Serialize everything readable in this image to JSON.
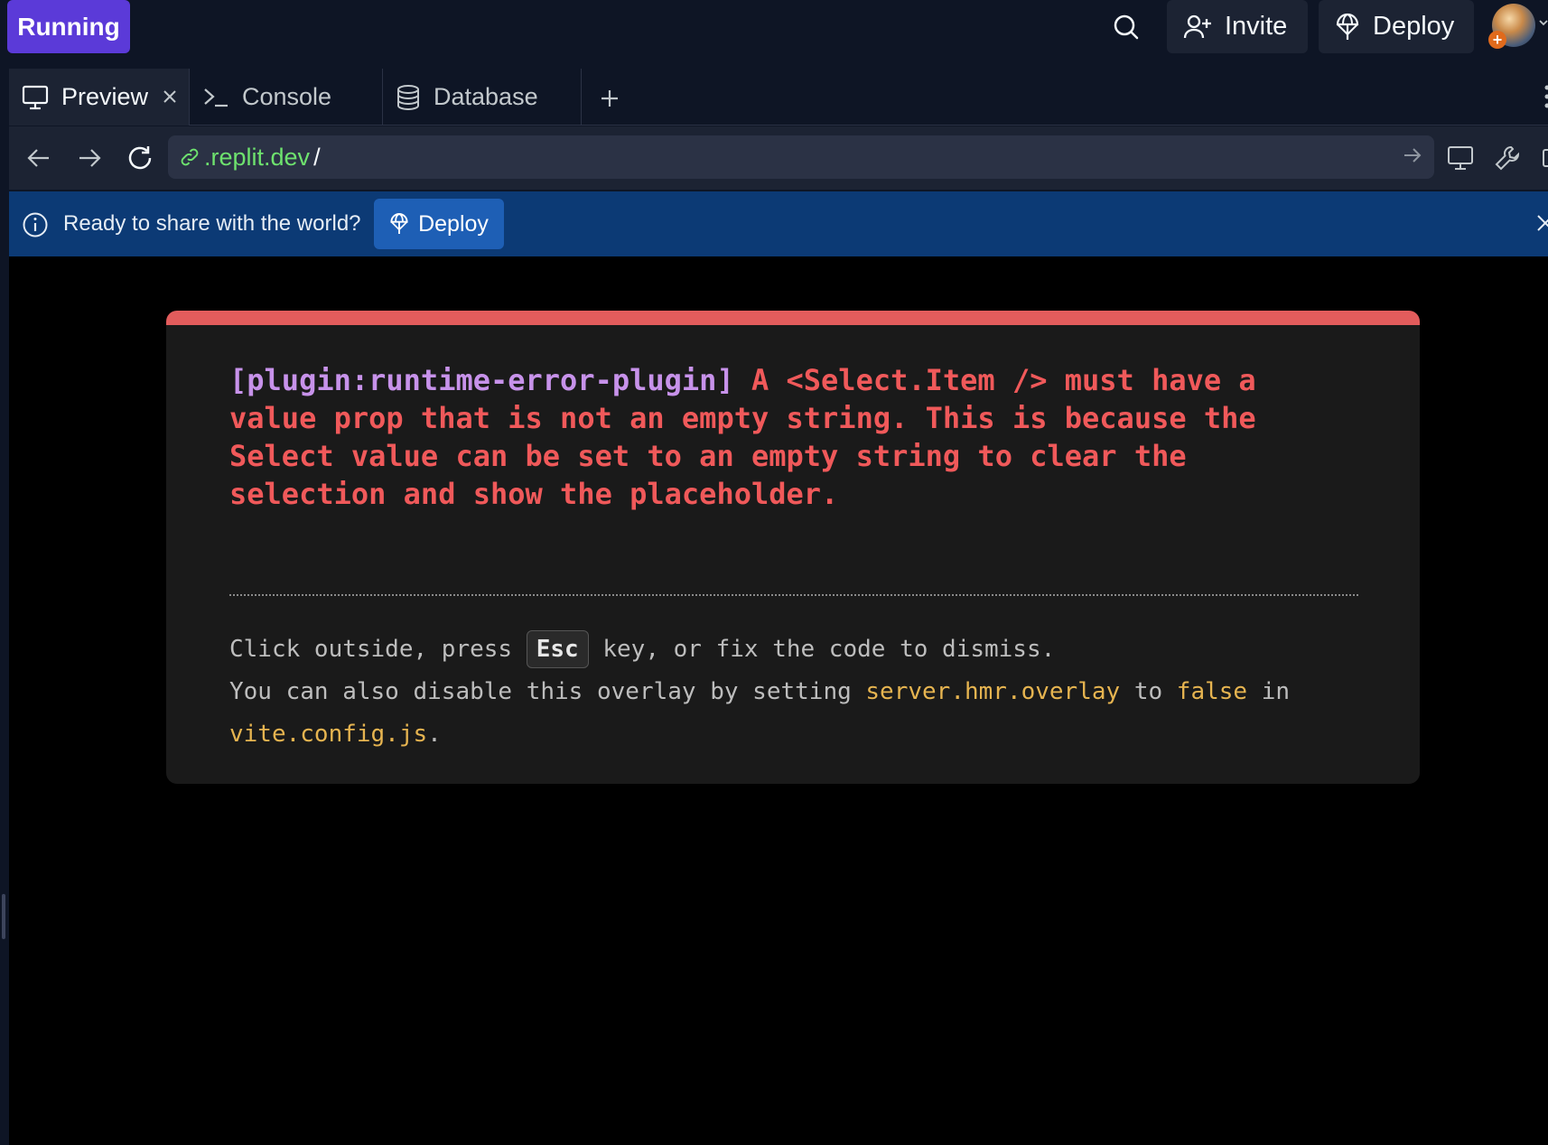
{
  "topbar": {
    "run_label": "Running",
    "invite_label": "Invite",
    "deploy_label": "Deploy",
    "icons": [
      "search-icon",
      "add-user-icon",
      "deploy-icon",
      "avatar",
      "chevron-down-icon"
    ]
  },
  "tabs": [
    {
      "label": "Preview",
      "icon": "monitor-icon",
      "active": true,
      "closable": true
    },
    {
      "label": "Console",
      "icon": "terminal-icon",
      "active": false
    },
    {
      "label": "Database",
      "icon": "database-icon",
      "active": false
    }
  ],
  "urlbar": {
    "url": ".replit.dev",
    "url_suffix": "/"
  },
  "banner": {
    "text": "Ready to share with the world?",
    "button_label": "Deploy"
  },
  "error": {
    "plugin": "[plugin:runtime-error-plugin]",
    "message": " A <Select.Item /> must have a value prop that is not an empty string. This is because the Select value can be set to an empty string to clear the selection and show the placeholder.",
    "tip_line1_before": "Click outside, press ",
    "tip_key": "Esc",
    "tip_line1_after": " key, or fix the code to dismiss.",
    "tip_line2_before": "You can also disable this overlay by setting ",
    "tip_code1": "server.hmr.overlay",
    "tip_mid": " to ",
    "tip_code2": "false",
    "tip_after": " in",
    "tip_code3": "vite.config.js",
    "tip_end": "."
  },
  "colors": {
    "run_button": "#5b3ad8",
    "banner": "#0c3a75",
    "error_bar": "#e25c5c",
    "error_text": "#f0595a",
    "plugin_text": "#c792ea",
    "code_highlight": "#e6b450",
    "url_text": "#6ee26e"
  }
}
